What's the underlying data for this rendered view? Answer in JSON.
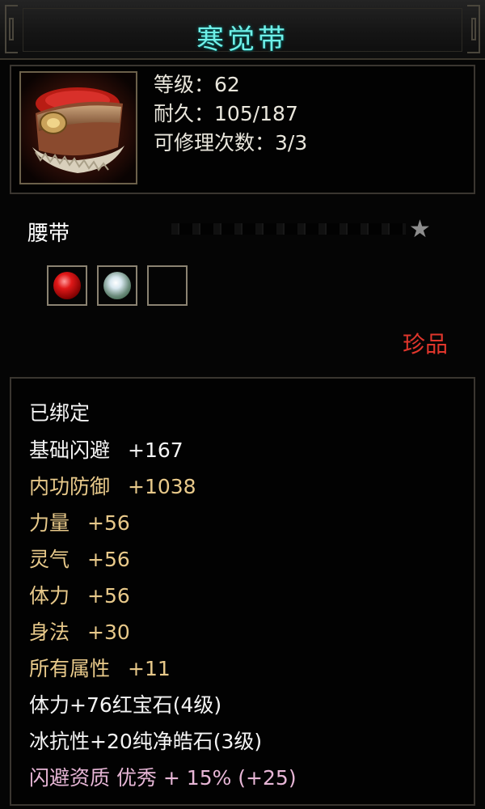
{
  "title": "寒觉带",
  "item": {
    "level_label": "等级：",
    "level_value": "62",
    "durability_label": "耐久：",
    "durability_value": "105/187",
    "repair_label": "可修理次数：",
    "repair_value": "3/3"
  },
  "type": "腰带",
  "rarity": "珍品",
  "sockets": [
    {
      "gem": "red-gem-icon",
      "color": "#e01818"
    },
    {
      "gem": "white-gem-icon",
      "color": "#d8e8f0"
    },
    {
      "gem": "empty-socket",
      "color": "#050505"
    }
  ],
  "bound": "已绑定",
  "attributes": [
    {
      "name": "基础闪避",
      "value": "+167",
      "color": "#f4f4f4"
    },
    {
      "name": "内功防御",
      "value": "+1038",
      "color": "#e8c98a"
    },
    {
      "name": "力量",
      "value": "+56",
      "color": "#e8c98a"
    },
    {
      "name": "灵气",
      "value": "+56",
      "color": "#e8c98a"
    },
    {
      "name": "体力",
      "value": "+56",
      "color": "#e8c98a"
    },
    {
      "name": "身法",
      "value": "+30",
      "color": "#e8c98a"
    },
    {
      "name": "所有属性",
      "value": "+11",
      "color": "#e8c98a"
    }
  ],
  "gem_lines": [
    "体力+76红宝石(4级)",
    "冰抗性+20纯净皓石(3级)"
  ],
  "quality_line": "闪避资质 优秀 + 15% (+25)",
  "colors": {
    "title": "#6ff0e8",
    "rarity": "#e0362c",
    "gold_text": "#e8c98a",
    "quality_text": "#e7b6d6"
  }
}
